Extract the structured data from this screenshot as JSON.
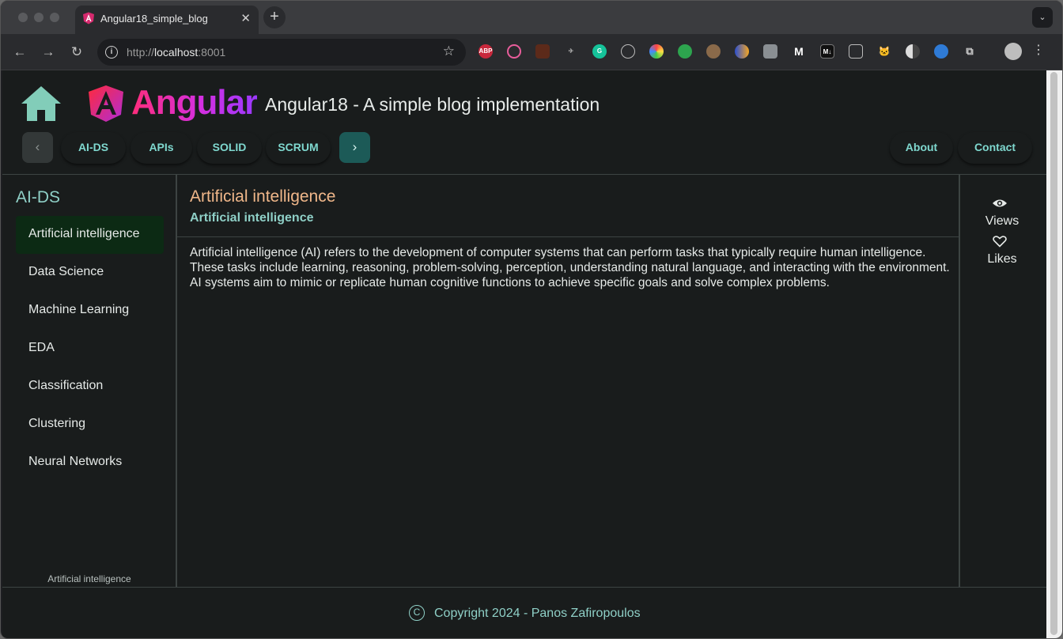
{
  "browser": {
    "tab_title": "Angular18_simple_blog",
    "tab_close": "✕",
    "new_tab": "+",
    "tab_menu": "⌄",
    "url_scheme": "http://",
    "url_host": "localhost",
    "url_port": ":8001",
    "extensions": [
      "abp-icon",
      "color-ring-icon",
      "notes-icon",
      "swift-icon",
      "grammarly-icon",
      "globe-icon",
      "colorzilla-icon",
      "github-icon",
      "owl-icon",
      "moon-icon",
      "image-icon",
      "medium-icon",
      "markdown-icon",
      "window-icon",
      "cat-icon",
      "half-circle-icon",
      "shield-icon",
      "puzzle-icon"
    ],
    "abp_label": "ABP",
    "markdown_label": "M↓"
  },
  "header": {
    "logo_word": "Angular",
    "site_title": "Angular18 - A simple blog implementation"
  },
  "nav": {
    "prev": "‹",
    "next": "›",
    "links": [
      "AI-DS",
      "APIs",
      "SOLID",
      "SCRUM"
    ],
    "right_links": [
      "About",
      "Contact"
    ]
  },
  "sidebar": {
    "title": "AI-DS",
    "items": [
      "Artificial intelligence",
      "Data Science",
      "Machine Learning",
      "EDA",
      "Classification",
      "Clustering",
      "Neural Networks"
    ],
    "active_index": 0,
    "footer": "Artificial intelligence"
  },
  "article": {
    "title": "Artificial intelligence",
    "subtitle": "Artificial intelligence",
    "body": "Artificial intelligence (AI) refers to the development of computer systems that can perform tasks that typically require human intelligence. These tasks include learning, reasoning, problem-solving, perception, understanding natural language, and interacting with the environment. AI systems aim to mimic or replicate human cognitive functions to achieve specific goals and solve complex problems."
  },
  "stats": {
    "views_label": "Views",
    "likes_label": "Likes"
  },
  "footer": {
    "copy_symbol": "C",
    "text": "Copyright 2024 - Panos Zafiropoulos"
  },
  "colors": {
    "accent_teal": "#8fd0c7",
    "accent_orange": "#f0b78a",
    "page_bg": "#191c1c",
    "active_item_bg": "#0c2a14"
  }
}
